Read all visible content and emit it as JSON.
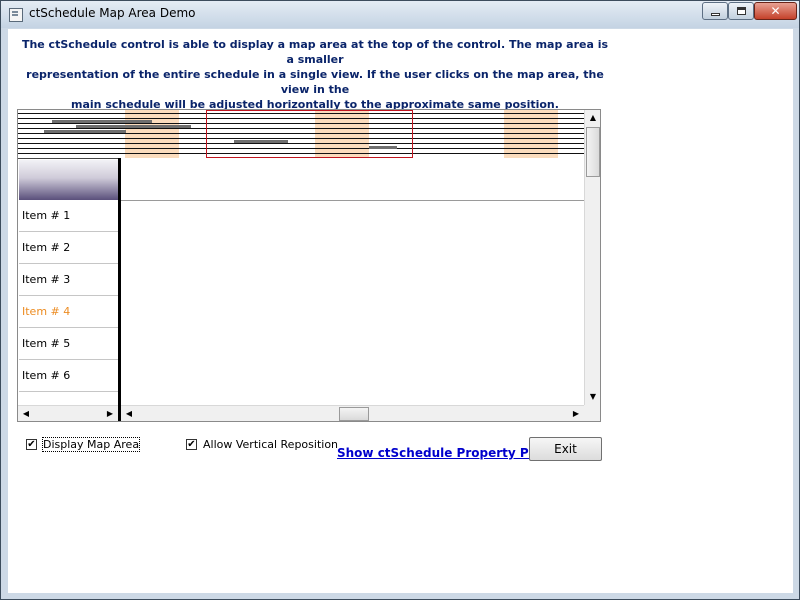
{
  "window": {
    "title": "ctSchedule Map Area Demo",
    "minimize_icon": "minimize-icon",
    "maximize_icon": "maximize-icon",
    "close_icon": "close-icon",
    "close_glyph": "✕"
  },
  "description": {
    "line1": "The ctSchedule control is able to display a map area at the top of the control. The map area is a smaller",
    "line2": "representation of the entire schedule in a single view. If the user clicks on the map area, the view in the",
    "line3": "main schedule will be adjusted horizontally to the approximate same position."
  },
  "schedule": {
    "items": [
      {
        "label": "Item # 1"
      },
      {
        "label": "Item # 2"
      },
      {
        "label": "Item # 3"
      },
      {
        "label": "Item # 4",
        "active": true
      },
      {
        "label": "Item # 5"
      },
      {
        "label": "Item # 6"
      }
    ],
    "active_item_color": "#ec8c22",
    "highlight_color": "#fbdcbd",
    "view_rect_color": "#c0151f",
    "scroll_up_glyph": "▲",
    "scroll_down_glyph": "▼",
    "scroll_left_glyph": "◀",
    "scroll_right_glyph": "▶"
  },
  "controls": {
    "display_map_area": {
      "label": "Display Map Area",
      "checked": true
    },
    "allow_vertical_reposition": {
      "label": "Allow Vertical Reposition",
      "checked": true
    },
    "check_glyph": "✔",
    "property_pages_link": "Show ctSchedule Property Pages",
    "exit_button": "Exit"
  }
}
